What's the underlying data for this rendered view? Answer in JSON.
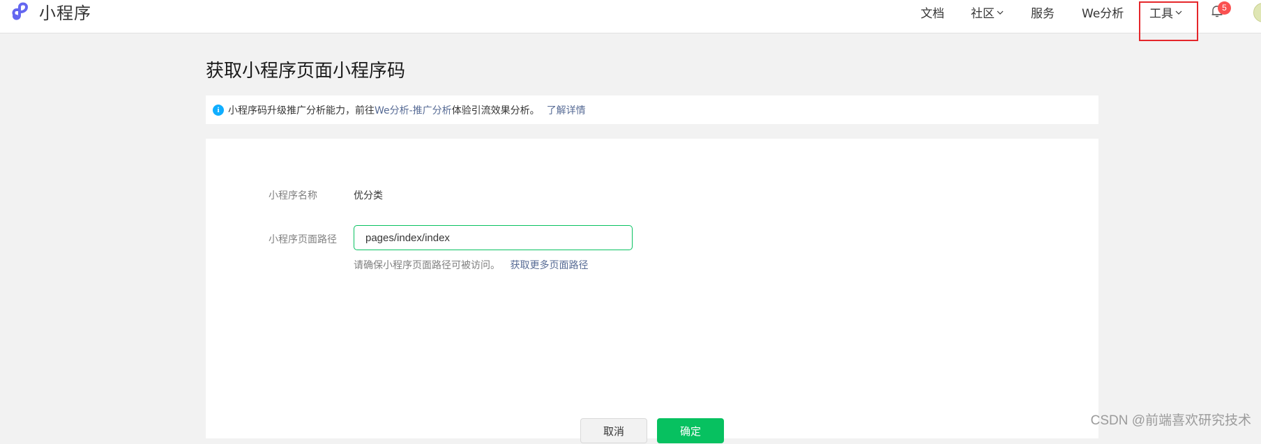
{
  "header": {
    "app_title": "小程序",
    "nav": {
      "docs": "文档",
      "community": "社区",
      "services": "服务",
      "we_analytics": "We分析",
      "tools": "工具"
    },
    "notification_count": "5"
  },
  "page": {
    "title": "获取小程序页面小程序码",
    "notice": {
      "text_before": "小程序码升级推广分析能力，前往",
      "link": "We分析-推广分析",
      "text_after": "体验引流效果分析。",
      "more_link": "了解详情"
    }
  },
  "form": {
    "name_label": "小程序名称",
    "name_value": "优分类",
    "path_label": "小程序页面路径",
    "path_value": "pages/index/index",
    "hint_text": "请确保小程序页面路径可被访问。",
    "hint_link": "获取更多页面路径",
    "cancel_label": "取消",
    "confirm_label": "确定"
  },
  "watermark": "CSDN @前端喜欢研究技术",
  "colors": {
    "accent_green": "#07c160",
    "link_blue": "#576b95",
    "info_blue": "#10aeff",
    "highlight_red": "#e5262a",
    "badge_red": "#fa5151"
  }
}
